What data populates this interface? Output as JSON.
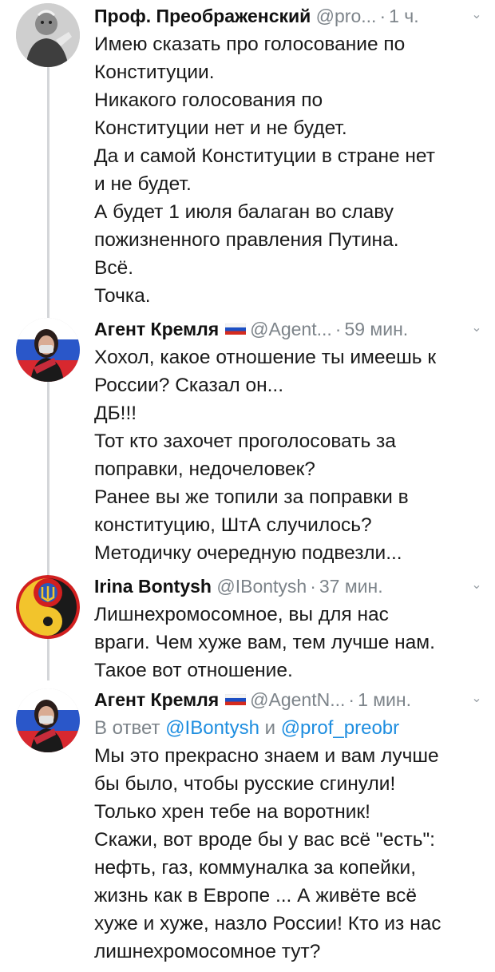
{
  "tweets": [
    {
      "name": "Проф. Преображенский",
      "handle": "@pro...",
      "dot": "·",
      "time": "1 ч.",
      "avatar_icon": "professor-portrait",
      "lines": [
        "Имею сказать про голосование по",
        "Конституции.",
        "Никакого голосования по",
        "Конституции нет и не будет.",
        "Да и самой Конституции в стране нет",
        "и не будет.",
        "А будет 1 июля балаган во славу",
        "пожизненного правления Путина.",
        "Всё.",
        "Точка."
      ]
    },
    {
      "name": "Агент Кремля",
      "flag": "russia-flag",
      "handle": "@Agent...",
      "dot": "·",
      "time": "59 мин.",
      "avatar_icon": "woman-with-flag",
      "lines": [
        "Хохол, какое отношение ты имеешь к",
        "России? Сказал он...",
        "ДБ!!!",
        "Тот кто захочет проголосовать за",
        "поправки, недочеловек?",
        "Ранее вы же топили за поправки в",
        "конституцию, ШтА случилось?",
        "Методичку очередную подвезли..."
      ]
    },
    {
      "name": "Irina Bontysh",
      "handle": "@IBontysh",
      "dot": "·",
      "time": "37 мин.",
      "avatar_icon": "trident-emblem",
      "lines": [
        "Лишнехромосомное, вы для нас",
        "враги. Чем хуже вам, тем лучше нам.",
        "Такое вот отношение."
      ]
    },
    {
      "name": "Агент Кремля",
      "flag": "russia-flag",
      "handle": "@AgentN...",
      "dot": "·",
      "time": "1 мин.",
      "avatar_icon": "woman-with-flag",
      "reply_prefix": "В ответ",
      "reply_mention_1": "@IBontysh",
      "reply_and": "и",
      "reply_mention_2": "@prof_preobr",
      "lines": [
        "Мы это прекрасно знаем и вам лучше",
        "бы было, чтобы русские сгинули!",
        "Только хрен тебе на воротник!",
        "Скажи, вот вроде бы у вас всё \"есть\":",
        "нефть, газ, коммуналка за копейки,",
        "жизнь как в Европе ... А живёте всё",
        "хуже и хуже, назло России! Кто из нас",
        "лишнехромосомное тут?"
      ]
    }
  ],
  "colors": {
    "secondary_text": "#7d848a",
    "mention": "#1e8ee0",
    "thread_line": "#d4d6d9"
  }
}
